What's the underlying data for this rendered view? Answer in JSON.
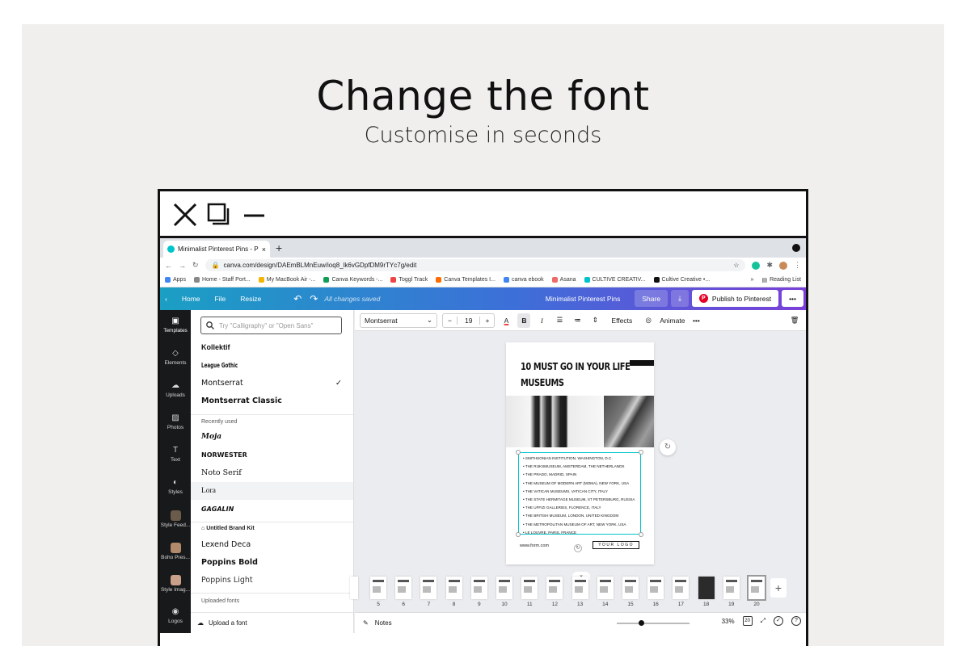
{
  "slide": {
    "headline": "Change the font",
    "subline": "Customise in seconds",
    "background": "#f0efed"
  },
  "window_controls": [
    "close-icon",
    "restore-icon",
    "minimize-icon"
  ],
  "browser": {
    "tab_title": "Minimalist Pinterest Pins - Pint",
    "tab_close": "×",
    "new_tab": "+",
    "url": "canva.com/design/DAEmBLMnEuw/ioq8_lk6vGDpfDM9rTYc7g/edit",
    "bookmarks": [
      "Apps",
      "Home - Staff Port...",
      "My MacBook Air -...",
      "Canva Keywords -...",
      "Toggl Track",
      "Canva Templates I...",
      "canva ebook",
      "Asana",
      "CULTIVE CREATIV...",
      "Cultive Creative •..."
    ],
    "bookmarks_more": "»",
    "reading_list": "Reading List"
  },
  "canva_top": {
    "back": "‹",
    "home": "Home",
    "file": "File",
    "resize": "Resize",
    "undo": "↶",
    "redo": "↷",
    "saved": "All changes saved",
    "design_title": "Minimalist Pinterest Pins",
    "share": "Share",
    "download": "⤓",
    "publish": "Publish to Pinterest",
    "more": "•••",
    "gradient": [
      "#1b9fc4",
      "#3d6fd8",
      "#7a40d8"
    ]
  },
  "rail": [
    {
      "label": "Templates",
      "icon": "templates-icon"
    },
    {
      "label": "Elements",
      "icon": "elements-icon"
    },
    {
      "label": "Uploads",
      "icon": "uploads-icon"
    },
    {
      "label": "Photos",
      "icon": "photos-icon"
    },
    {
      "label": "Text",
      "icon": "text-icon"
    },
    {
      "label": "Styles",
      "icon": "styles-icon"
    },
    {
      "label": "Style Feed...",
      "icon": "thumb"
    },
    {
      "label": "Boho Pres...",
      "icon": "thumb"
    },
    {
      "label": "Style Imag...",
      "icon": "thumb"
    },
    {
      "label": "Logos",
      "icon": "logos-icon"
    }
  ],
  "font_panel": {
    "search_placeholder": "Try \"Calligraphy\" or \"Open Sans\"",
    "fonts_top": [
      "Kollektif",
      "League Gothic",
      "Montserrat",
      "Montserrat Classic"
    ],
    "selected_font": "Montserrat",
    "recent_label": "Recently used",
    "recent": [
      "Moja",
      "NORWESTER",
      "Noto Serif",
      "Lora",
      "GAGALIN"
    ],
    "brand_label": "Untitled Brand Kit",
    "brand": [
      "Lexend Deca",
      "Poppins Bold",
      "Poppins Light"
    ],
    "uploaded_label": "Uploaded fonts",
    "upload_label": "Upload a font"
  },
  "toolbar": {
    "font": "Montserrat",
    "minus": "−",
    "size": "19",
    "plus": "+",
    "text_color": "A",
    "bold": "B",
    "italic": "I",
    "effects": "Effects",
    "animate": "Animate",
    "more": "•••"
  },
  "design": {
    "title_line1": "10 MUST GO IN YOUR LIFE",
    "title_line2": "MUSEUMS",
    "list": [
      "SMITHSONIAN INSTITUTION, WASHINGTON, D.C.",
      "THE RIJKSMUSEUM, AMSTERDAM, THE NETHERLANDS",
      "THE PRADO, MADRID, SPAIN",
      "THE MUSEUM OF MODERN ART (MOMA), NEW YORK, USA",
      "THE VATICAN MUSEUMS, VATICAN CITY, ITALY",
      "THE STATE HERMITAGE MUSEUM, ST PETERSBURG, RUSSIA",
      "THE UFFIZI GALLERIES, FLORENCE, ITALY",
      "THE BRITISH MUSEUM, LONDON, UNITED KINGDOM",
      "THE METROPOLITAN MUSEUM OF ART, NEW YORK, USA",
      "LE LOUVRE, PARIS, FRANCE"
    ],
    "website": "www.form.com",
    "logo": "YOUR LOGO",
    "accent": "#00c4cc"
  },
  "pages": {
    "numbers": [
      "5",
      "6",
      "7",
      "8",
      "9",
      "10",
      "11",
      "12",
      "13",
      "14",
      "15",
      "16",
      "17",
      "18",
      "19",
      "20"
    ],
    "selected": "20",
    "add": "+",
    "collapse": "⌄"
  },
  "bottom": {
    "notes": "Notes",
    "zoom": "33%",
    "zoom_fraction": 0.33,
    "page_count": "20",
    "help": "?"
  }
}
